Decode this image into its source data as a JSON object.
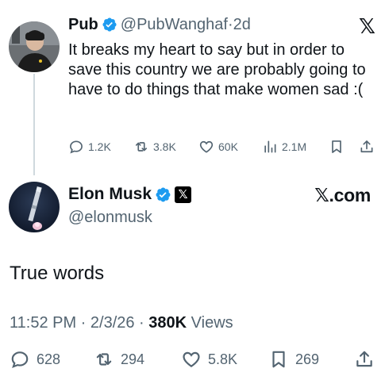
{
  "quoted": {
    "name": "Pub",
    "handle_time": "@PubWanghaf·2d",
    "text": "It breaks my heart to say but in order to save this country we are probably going to have to do things that make women sad :(",
    "stats": {
      "replies": "1.2K",
      "reposts": "3.8K",
      "likes": "60K",
      "views": "2.1M"
    }
  },
  "top_logo": "𝕏",
  "author": {
    "name": "Elon Musk",
    "handle": "@elonmusk",
    "affiliate_badge": "𝕏"
  },
  "site_label": "𝕏.com",
  "post": {
    "text": "True words",
    "time_date": "11:52 PM · 2/3/26 · ",
    "views_count": "380K",
    "views_label": " Views"
  },
  "actions": {
    "replies": "628",
    "reposts": "294",
    "likes": "5.8K",
    "bookmarks": "269"
  },
  "colors": {
    "verified": "#1d9bf0",
    "muted": "#536471",
    "text": "#0f1419"
  }
}
